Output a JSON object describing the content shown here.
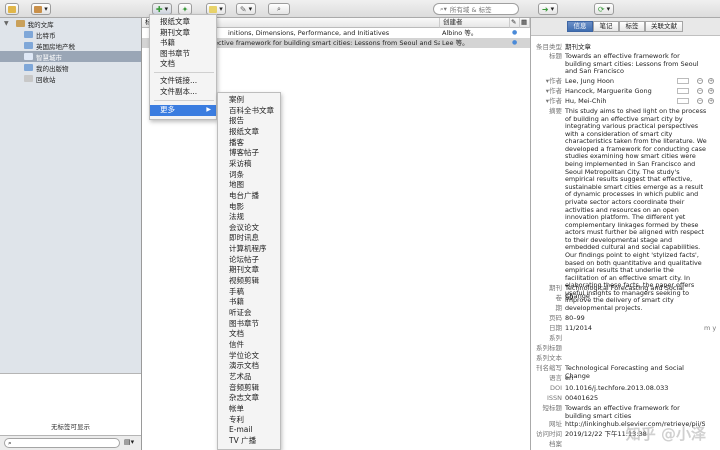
{
  "toolbar": {
    "search_placeholder": "所有域 & 标签",
    "new_item_icon": "green-plus-icon",
    "colors": {
      "accent": "#3b7de0",
      "green": "#3c9a3c"
    }
  },
  "collections": {
    "items": [
      {
        "label": "我的文库",
        "type": "library",
        "selected": false
      },
      {
        "label": "比特币",
        "type": "folder",
        "selected": false
      },
      {
        "label": "英国房地产税",
        "type": "folder",
        "selected": false
      },
      {
        "label": "智慧城市",
        "type": "folder",
        "selected": true
      },
      {
        "label": "我的出版物",
        "type": "folder",
        "selected": false
      },
      {
        "label": "回收站",
        "type": "trash",
        "selected": false
      }
    ],
    "tag_empty": "无标签可显示"
  },
  "items_table": {
    "col_title": "标题",
    "col_creator": "创建者",
    "rows": [
      {
        "title": "initions, Dimensions, Performance, and Initiatives",
        "creator": "Albino 等。"
      },
      {
        "title": "ective framework for building smart cities: Lessons from Seoul and San Francisco",
        "creator": "Lee 等。"
      }
    ]
  },
  "item_type_menu": {
    "items": [
      "报纸文章",
      "期刊文章",
      "书籍",
      "图书章节",
      "文档"
    ],
    "link_items": [
      "文件链接...",
      "文件副本..."
    ],
    "more_label": "更多",
    "submenu": [
      "案例",
      "百科全书文章",
      "报告",
      "报纸文章",
      "播客",
      "博客帖子",
      "采访稿",
      "词条",
      "地图",
      "电台广播",
      "电影",
      "法规",
      "会议论文",
      "即时讯息",
      "计算机程序",
      "论坛帖子",
      "期刊文章",
      "视频剪辑",
      "手稿",
      "书籍",
      "听证会",
      "图书章节",
      "文档",
      "信件",
      "学位论文",
      "演示文档",
      "艺术品",
      "音频剪辑",
      "杂志文章",
      "帐单",
      "专利",
      "E-mail",
      "TV 广播"
    ]
  },
  "info_pane": {
    "tabs": [
      "信息",
      "笔记",
      "标签",
      "关联文献"
    ],
    "active_tab": "信息",
    "fields": {
      "item_type_label": "条目类型",
      "item_type": "期刊文章",
      "title_label": "标题",
      "title": "Towards an effective framework for building smart cities: Lessons from Seoul and San Francisco",
      "author_label": "作者",
      "authors": [
        "Lee, Jung Hoon",
        "Hancock, Marguerite Gong",
        "Hu, Mei-Chih"
      ],
      "abstract_label": "摘要",
      "abstract": "This study aims to shed light on the process of building an effective smart city by integrating various practical perspectives with a consideration of smart city characteristics taken from the literature. We developed a framework for conducting case studies examining how smart cities were being implemented in San Francisco and Seoul Metropolitan City. The study's empirical results suggest that effective, sustainable smart cities emerge as a result of dynamic processes in which public and private sector actors coordinate their activities and resources on an open innovation platform. The different yet complementary linkages formed by these actors must further be aligned with respect to their developmental stage and embedded cultural and social capabilities. Our findings point to eight 'stylized facts', based on both quantitative and qualitative empirical results that underlie the facilitation of an effective smart city. In elaborating these facts, the paper offers useful insights to managers seeking to improve the delivery of smart city developmental projects.",
      "publication_label": "期刊",
      "publication": "Technological Forecasting and Social Change",
      "volume_label": "卷",
      "volume": "89",
      "issue_label": "期",
      "issue": "",
      "pages_label": "页码",
      "pages": "80–99",
      "date_label": "日期",
      "date": "11/2014",
      "date_order": "m y",
      "series_label": "系列",
      "series_title_label": "系列标题",
      "series_text_label": "系列文本",
      "journal_abbr_label": "刊名缩写",
      "journal_abbr": "Technological Forecasting and Social Change",
      "language_label": "语言",
      "language": "en",
      "doi_label": "DOI",
      "doi": "10.1016/j.techfore.2013.08.033",
      "issn_label": "ISSN",
      "issn": "00401625",
      "short_title_label": "短标题",
      "short_title": "Towards an effective framework for building smart cities",
      "url_label": "网址",
      "url": "http://linkinghub.elsevier.com/retrieve/pii/S0...",
      "accessed_label": "访问时间",
      "accessed": "2019/12/22 下午11:13:38",
      "archive_label": "档案"
    }
  },
  "watermark": "知乎 @小泽"
}
